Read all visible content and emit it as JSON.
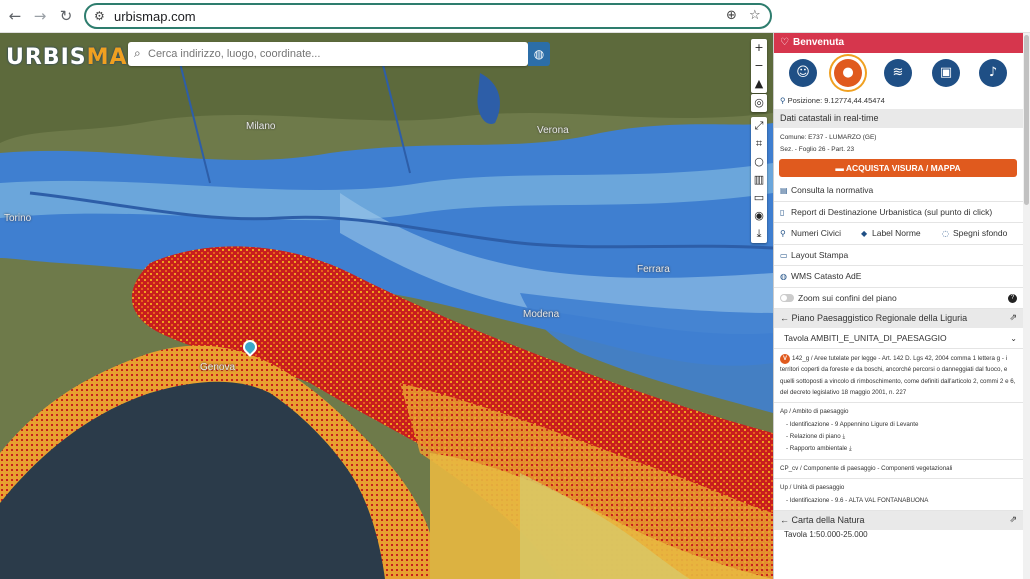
{
  "browser": {
    "back_icon": "arrow-back-icon",
    "forward_icon": "arrow-forward-icon",
    "reload_icon": "reload-icon",
    "url": "urbismap.com",
    "colors": {
      "url_border": "#2e7d6e"
    }
  },
  "map": {
    "logo_part1": "URBIS",
    "logo_part2": "MAP",
    "search_placeholder": "Cerca indirizzo, luogo, coordinate...",
    "labels": {
      "milano": "Milano",
      "verona": "Verona",
      "torino": "Torino",
      "ferrara": "Ferrara",
      "modena": "Modena",
      "genova": "Genova"
    },
    "colors": {
      "sea": "#2b3b4a",
      "flood": "#3f7fd0",
      "risk_high": "#c81e1e",
      "risk_mid": "#f0a020"
    }
  },
  "panel": {
    "welcome": "Benvenuta",
    "position": "Posizione: 9.12774,44.45474",
    "cadastral_header": "Dati catastali in real-time",
    "comune": "Comune: E737 - LUMARZO (GE)",
    "sezione": "Sez. - Foglio 26 - Part. 23",
    "buy_label": "ACQUISTA VISURA / MAPPA",
    "consulta": "Consulta la normativa",
    "report": "Report di Destinazione Urbanistica (sul punto di click)",
    "numeri_civici": "Numeri Civici",
    "label_norme": "Label Norme",
    "spegni_sfondo": "Spegni sfondo",
    "layout_stampa": "Layout Stampa",
    "wms": "WMS Catasto AdE",
    "zoom_confini": "Zoom sui confini del piano",
    "piano_header": "Piano Paesaggistico Regionale della Liguria",
    "tavola": "Tavola AMBITI_E_UNITA_DI_PAESAGGIO",
    "paragraph": "142_g / Aree tutelate per legge - Art. 142 D. Lgs 42, 2004 comma 1 lettera g - i territori coperti da foreste e da boschi, ancorché percorsi o danneggiati dal fuoco, e quelli sottoposti a vincolo di rimboschimento, come definiti dall'articolo 2, commi 2 e 6, del decreto legislativo 18 maggio 2001, n. 227",
    "ap_title": "Ap / Ambito di paesaggio",
    "ap_ident": "- Identificazione - 9 Appennino Ligure di Levante",
    "ap_rel": "- Relazione di piano",
    "ap_rapp": "- Rapporto ambientale",
    "cp": "CP_cv / Componente di paesaggio - Componenti vegetazionali",
    "up_title": "Up / Unità di paesaggio",
    "up_ident": "- Identificazione - 9.6 - ALTA VAL FONTANABUONA",
    "natura_header": "Carta della Natura",
    "scale_row": "Tavola 1:50.000-25.000",
    "colors": {
      "welcome_bg": "#d6364d",
      "icon_bg": "#1f4f85",
      "accent": "#e05a1e",
      "highlight": "#f0a020"
    },
    "icons": [
      "user-icon",
      "map-pin-icon",
      "layers-icon",
      "id-card-icon",
      "bell-icon"
    ]
  }
}
